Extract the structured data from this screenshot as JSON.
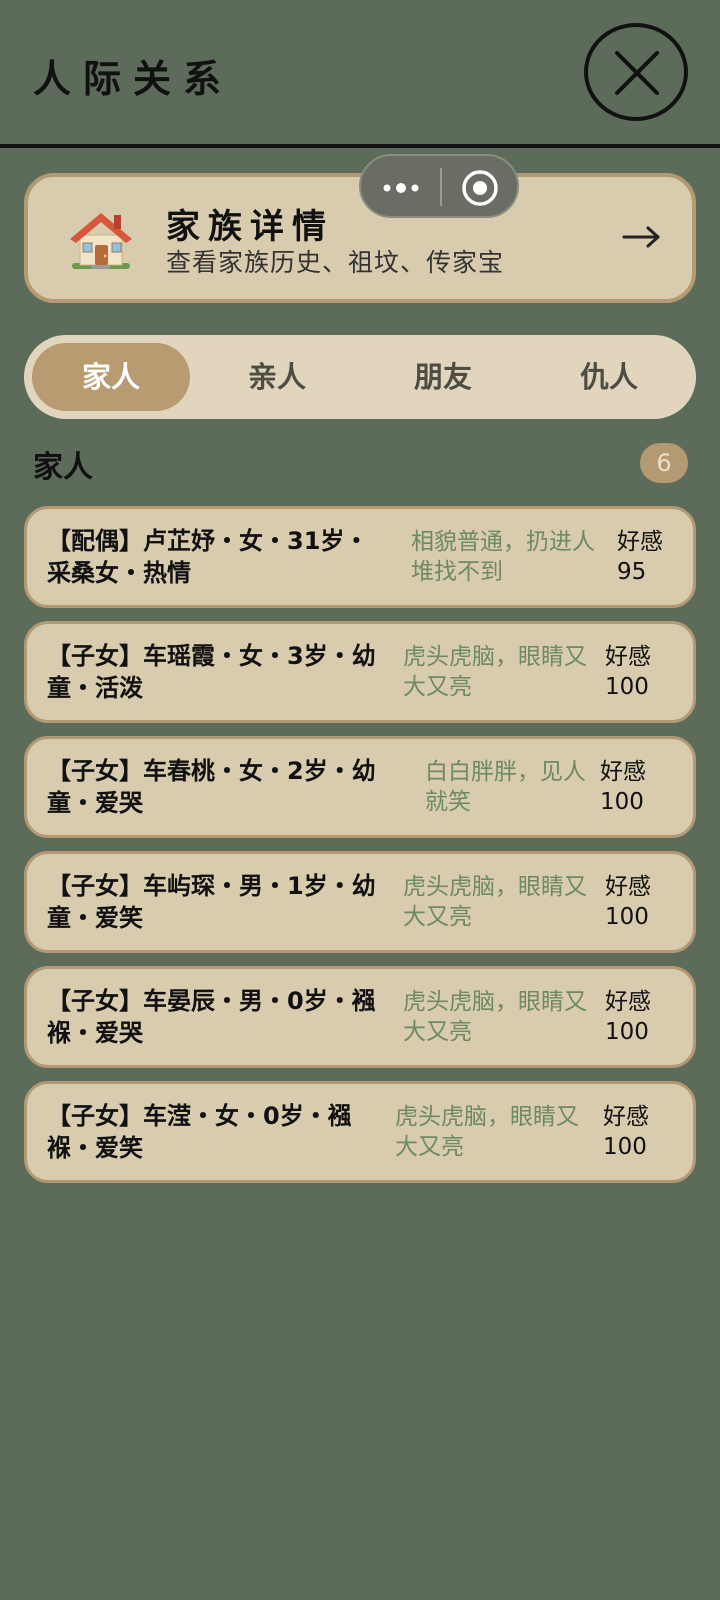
{
  "header": {
    "title": "人际关系"
  },
  "family_card": {
    "title": "家族详情",
    "subtitle": "查看家族历史、祖坟、传家宝",
    "icon": "house-icon"
  },
  "tabs": [
    {
      "label": "家人",
      "active": true
    },
    {
      "label": "亲人",
      "active": false
    },
    {
      "label": "朋友",
      "active": false
    },
    {
      "label": "仇人",
      "active": false
    }
  ],
  "section": {
    "title": "家人",
    "count": "6"
  },
  "members": [
    {
      "info": "【配偶】卢芷妤・女・31岁・采桑女・热情",
      "desc": "相貌普通，扔进人堆找不到",
      "favor_label": "好感",
      "favor_value": "95"
    },
    {
      "info": "【子女】车瑶霞・女・3岁・幼童・活泼",
      "desc": "虎头虎脑，眼睛又大又亮",
      "favor_label": "好感",
      "favor_value": "100"
    },
    {
      "info": "【子女】车春桃・女・2岁・幼童・爱哭",
      "desc": "白白胖胖，见人就笑",
      "favor_label": "好感",
      "favor_value": "100"
    },
    {
      "info": "【子女】车屿琛・男・1岁・幼童・爱笑",
      "desc": "虎头虎脑，眼睛又大又亮",
      "favor_label": "好感",
      "favor_value": "100"
    },
    {
      "info": "【子女】车晏辰・男・0岁・襁褓・爱哭",
      "desc": "虎头虎脑，眼睛又大又亮",
      "favor_label": "好感",
      "favor_value": "100"
    },
    {
      "info": "【子女】车滢・女・0岁・襁褓・爱笑",
      "desc": "虎头虎脑，眼睛又大又亮",
      "favor_label": "好感",
      "favor_value": "100"
    }
  ],
  "colors": {
    "background": "#5d6b5a",
    "card": "#d8cbae",
    "card_border": "#b39a72",
    "tab_active": "#b89b70",
    "desc_text": "#6e8a60"
  }
}
